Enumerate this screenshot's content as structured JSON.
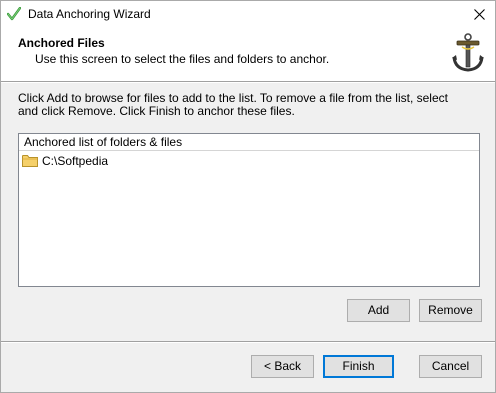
{
  "window": {
    "title": "Data Anchoring Wizard"
  },
  "header": {
    "title": "Anchored Files",
    "subtitle": "Use this screen to select the files and folders to anchor.",
    "icon": "anchor-icon"
  },
  "instructions": "Click Add to browse for files to add to the list. To remove a file from the list, select and click Remove. Click Finish to anchor these files.",
  "list": {
    "header": "Anchored list of folders & files",
    "items": [
      {
        "label": "C:\\Softpedia",
        "icon": "folder-icon"
      }
    ]
  },
  "buttons": {
    "add": "Add",
    "remove": "Remove",
    "back": "< Back",
    "finish": "Finish",
    "cancel": "Cancel"
  },
  "colors": {
    "accent": "#0078d7",
    "folder": "#f5d06a"
  }
}
